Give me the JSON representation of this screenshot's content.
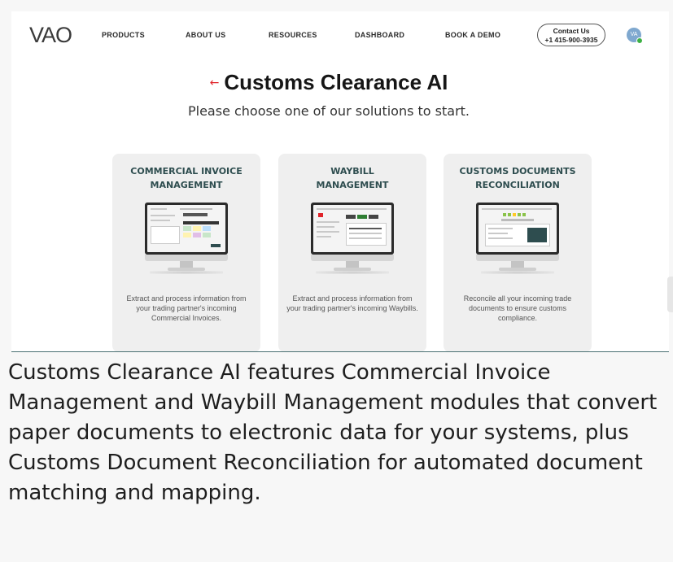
{
  "nav": {
    "logo": "VAO",
    "links": [
      "PRODUCTS",
      "ABOUT US",
      "RESOURCES",
      "DASHBOARD",
      "BOOK A DEMO"
    ],
    "contact_label": "Contact Us",
    "contact_phone": "+1 415-900-3935",
    "avatar_initials": "VA"
  },
  "page": {
    "back_icon": "back-arrow-icon",
    "title": "Customs Clearance AI",
    "subtitle": "Please choose one of our solutions to start."
  },
  "cards": [
    {
      "title_line1": "COMMERCIAL INVOICE",
      "title_line2": "MANAGEMENT",
      "description": "Extract and process information from your trading partner's incoming Commercial Invoices."
    },
    {
      "title_line1": "WAYBILL",
      "title_line2": "MANAGEMENT",
      "description": "Extract and process information from your trading partner's incoming Waybills."
    },
    {
      "title_line1": "CUSTOMS DOCUMENTS",
      "title_line2": "RECONCILIATION",
      "description": "Reconcile all your incoming trade documents to ensure customs compliance."
    }
  ],
  "caption": "Customs Clearance AI features Commercial Invoice Management and Waybill Management modules that convert paper documents to electronic data for your systems, plus Customs Document Reconciliation for automated document matching and mapping.",
  "colors": {
    "accent_red": "#e0242a",
    "card_title": "#2e4d4f",
    "status_online": "#3cb043"
  }
}
